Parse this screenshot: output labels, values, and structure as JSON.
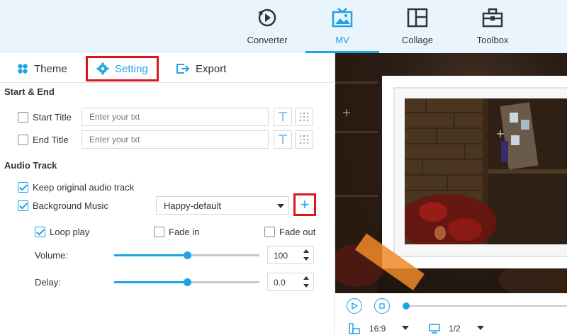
{
  "nav": {
    "items": [
      {
        "label": "Converter",
        "icon": "converter-icon"
      },
      {
        "label": "MV",
        "icon": "mv-icon",
        "active": true
      },
      {
        "label": "Collage",
        "icon": "collage-icon"
      },
      {
        "label": "Toolbox",
        "icon": "toolbox-icon"
      }
    ]
  },
  "tabs": {
    "theme": "Theme",
    "setting": "Setting",
    "export": "Export"
  },
  "start_end": {
    "title": "Start & End",
    "start_title_label": "Start Title",
    "start_title_placeholder": "Enter your txt",
    "start_title_checked": false,
    "end_title_label": "End Title",
    "end_title_placeholder": "Enter your txt",
    "end_title_checked": false
  },
  "audio": {
    "title": "Audio Track",
    "keep_original_label": "Keep original audio track",
    "keep_original_checked": true,
    "background_music_label": "Background Music",
    "background_music_checked": true,
    "music_selected": "Happy-default",
    "add_symbol": "+",
    "loop_label": "Loop play",
    "loop_checked": true,
    "fade_in_label": "Fade in",
    "fade_in_checked": false,
    "fade_out_label": "Fade out",
    "fade_out_checked": false,
    "volume_label": "Volume:",
    "volume_value": "100",
    "volume_fraction": 0.5,
    "delay_label": "Delay:",
    "delay_value": "0.0",
    "delay_fraction": 0.5
  },
  "player": {
    "aspect_ratio": "16:9",
    "page": "1/2",
    "progress_fraction": 0.0
  },
  "colors": {
    "accent": "#1fa3e6",
    "highlight": "#e0141b"
  }
}
